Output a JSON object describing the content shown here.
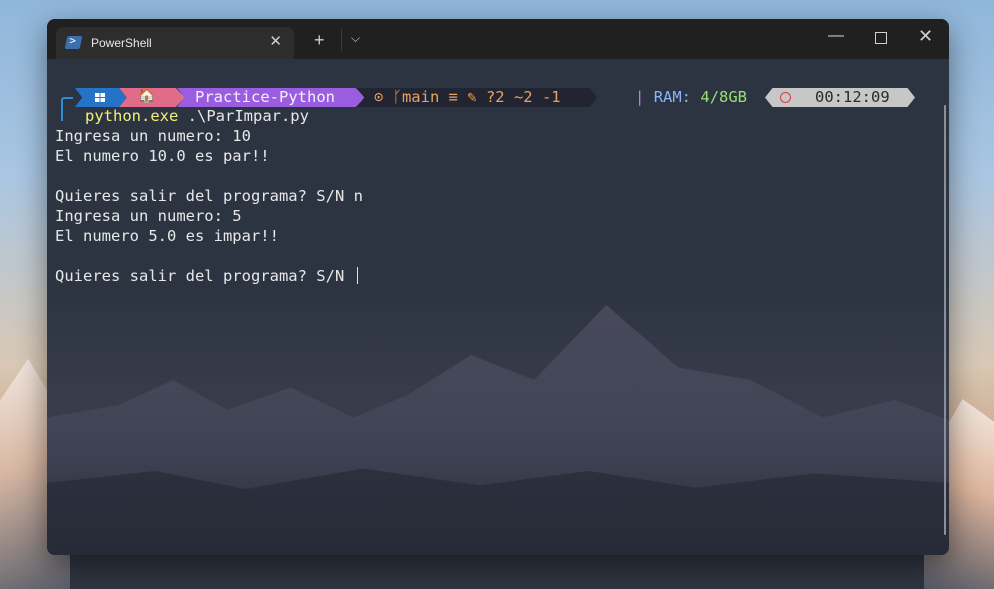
{
  "window": {
    "tab_title": "PowerShell",
    "tab_icon": "powershell-icon",
    "new_tab_label": "+",
    "dropdown_label": "⌵",
    "tab_close_label": "✕",
    "min_label": "—",
    "close_label": "✕"
  },
  "prompt": {
    "os_icon": "windows-icon",
    "home_icon": "🏠",
    "path": "Practice-Python",
    "git": "⊙ ᚴmain ≡ ✎ ?2 ~2 -1",
    "ram_pipe": "|",
    "ram_label": "RAM:",
    "ram_value": "4/8GB",
    "time": "00:12:09",
    "colors": {
      "os": "#2573c7",
      "home": "#e06c89",
      "path": "#9b5de0",
      "git_text": "#e9a35e",
      "ram_value": "#98e06f"
    }
  },
  "terminal": {
    "command_exe": "python.exe",
    "command_arg": " .\\ParImpar.py",
    "lines": [
      "Ingresa un numero: 10",
      "El numero 10.0 es par!!",
      "",
      "Quieres salir del programa? S/N n",
      "Ingresa un numero: 5",
      "El numero 5.0 es impar!!",
      "",
      "Quieres salir del programa? S/N "
    ]
  }
}
